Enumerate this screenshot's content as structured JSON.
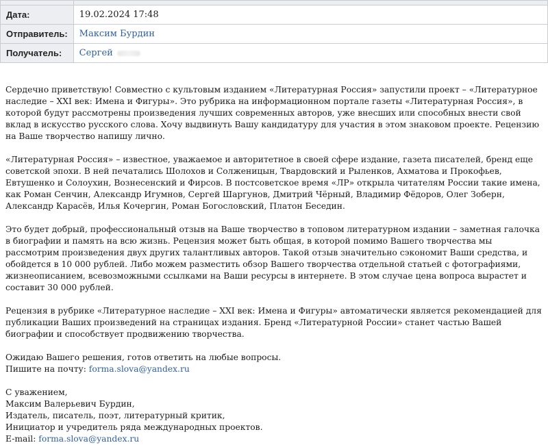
{
  "header": {
    "date_label": "Дата:",
    "date_value": "19.02.2024 17:48",
    "sender_label": "Отправитель:",
    "sender_value": "Максим Бурдин",
    "recipient_label": "Получатель:",
    "recipient_value": "Сергей"
  },
  "body": {
    "p1": "Сердечно приветствую! Совместно с культовым изданием «Литературная Россия» запустили проект – «Литературное наследие – XXI век: Имена и Фигуры». Это рубрика на информационном портале газеты «Литературная Россия», в которой будут рассмотрены произведения лучших современных авторов, уже внесших или способных внести свой вклад в искусство русского слова. Хочу выдвинуть Вашу кандидатуру для участия в этом знаковом проекте. Рецензию на Ваше творчество напишу лично.",
    "p2": "«Литературная Россия» – известное, уважаемое и авторитетное в своей сфере издание, газета писателей, бренд еще советской эпохи. В ней печатались Шолохов и Солженицын, Твардовский и Рыленков, Ахматова и Прокофьев, Евтушенко и Солоухин, Вознесенский и Фирсов. В постсоветское время «ЛР» открыла читателям России такие имена, как Роман Сенчин, Александр Игумнов, Сергей Шаргунов, Дмитрий Чёрный, Владимир Фёдоров, Олег Зоберн, Александр Карасёв, Илья Кочергин, Роман Богословский, Платон Беседин.",
    "p3": "Это будет добрый, профессиональный отзыв на Ваше творчество в топовом литературном издании – заметная галочка в биографии и память на всю жизнь. Рецензия может быть общая, в которой помимо Вашего творчества мы рассмотрим произведения двух других талантливых авторов. Такой отзыв значительно сэкономит Ваши средства, и обойдется в 10 000 рублей. Либо можем разместить обзор Вашего творчества отдельной статьей с фотографиями, жизнеописанием, всевозможными ссылками на Ваши ресурсы в интернете. В этом случае цена вопроса вырастет и составит 30 000 рублей.",
    "p4": "Рецензия в рубрике «Литературное наследие – XXI век: Имена и Фигуры» автоматически является рекомендацией для публикации Ваших произведений на страницах издания. Бренд «Литературной России» станет частью Вашей биографии и способствует продвижению творчества.",
    "p5_line1": "Ожидаю Вашего решения, готов ответить на любые вопросы.",
    "p5_line2_prefix": "Пишите на почту: ",
    "email": "forma.slova@yandex.ru",
    "sig_line1": "С уважением,",
    "sig_line2": "Максим Валерьевич Бурдин,",
    "sig_line3": "Издатель, писатель, поэт, литературный критик,",
    "sig_line4": "Инициатор и учредитель ряда международных проектов.",
    "sig_email_prefix": "E-mail: ",
    "sig_email": "forma.slova@yandex.ru"
  }
}
